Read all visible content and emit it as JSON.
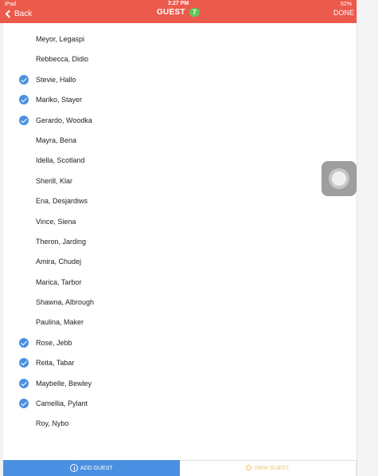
{
  "status_bar": {
    "carrier": "iPad",
    "time": "3:27 PM",
    "battery": "52%"
  },
  "nav": {
    "back_label": "Back",
    "title": "GUEST",
    "badge_count": "7",
    "done_label": "DONE"
  },
  "guests": [
    {
      "name": "Meyor, Legaspi",
      "checked": false
    },
    {
      "name": "Rebbecca, Didio",
      "checked": false
    },
    {
      "name": "Stevie, Hallo",
      "checked": true
    },
    {
      "name": "Mariko, Stayer",
      "checked": true
    },
    {
      "name": "Gerardo, Woodka",
      "checked": true
    },
    {
      "name": "Mayra, Bena",
      "checked": false
    },
    {
      "name": "Idella, Scotland",
      "checked": false
    },
    {
      "name": "Sherill, Klar",
      "checked": false
    },
    {
      "name": "Ena, Desjardiws",
      "checked": false
    },
    {
      "name": "Vince, Siena",
      "checked": false
    },
    {
      "name": "Theron, Jarding",
      "checked": false
    },
    {
      "name": "Amira, Chudej",
      "checked": false
    },
    {
      "name": "Marica, Tarbor",
      "checked": false
    },
    {
      "name": "Shawna, Albrough",
      "checked": false
    },
    {
      "name": "Paulina, Maker",
      "checked": false
    },
    {
      "name": "Rose, Jebb",
      "checked": true
    },
    {
      "name": "Reita, Tabar",
      "checked": true
    },
    {
      "name": "Maybelle, Bewley",
      "checked": true
    },
    {
      "name": "Camellia, Pylant",
      "checked": true
    },
    {
      "name": "Roy, Nybo",
      "checked": false
    }
  ],
  "bottom_tabs": {
    "add_label": "ADD GUEST",
    "view_label": "VIEW GUEST"
  },
  "colors": {
    "nav_bar": "#ec5a4c",
    "badge": "#5cc75a",
    "check": "#4a90e2",
    "add_tab": "#4a90e2",
    "view_tab_text": "#e9c46a"
  },
  "icons": {
    "back": "chevron-left-icon",
    "check": "checkmark-circle-icon",
    "add": "add-circle-icon",
    "view": "eye-icon",
    "assistive_touch": "assistive-touch-icon"
  }
}
